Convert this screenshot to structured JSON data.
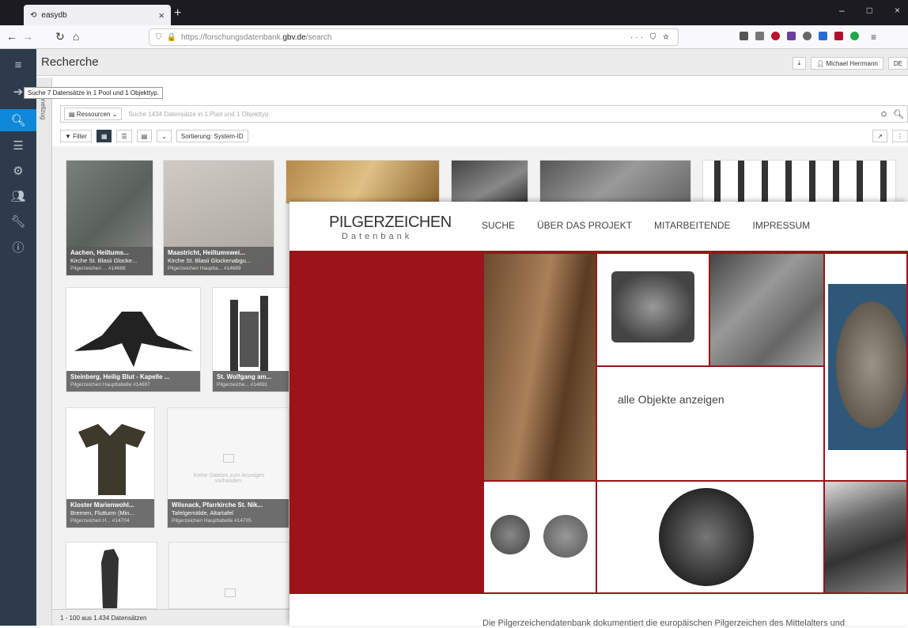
{
  "browser": {
    "tab_title": "easydb",
    "url_prefix": "https://forschungsdatenbank.",
    "url_domain": "gbv.de",
    "url_suffix": "/search"
  },
  "app": {
    "title": "Recherche",
    "user": "Michael Herrmann",
    "lang": "DE",
    "tooltip": "Suche 7 Datensätze in 1 Pool und 1 Objekttyp.",
    "schnellzugriff": "Schnellzug",
    "resources_label": "Ressourcen",
    "search_placeholder": "Suche 1434 Datensätze in 1 Pool und 1 Objekttyp.",
    "filter_label": "Filter",
    "sort_label": "Sortierung: System-ID",
    "status": "1 - 100 aus 1.434 Datensätzen"
  },
  "cards": [
    {
      "title": "Aachen, Heiltums...",
      "sub": "Kirche St. Blasii Glocke...",
      "meta": "Pilgerzeichen ...  #14688"
    },
    {
      "title": "Maastricht, Heiltumswei...",
      "sub": "Kirche St. Blasii Glockenabgu...",
      "meta": "Pilgerzeichen Haupttа...  #14689"
    },
    {
      "title": "Steinberg, Heilig Blut - Kapelle ...",
      "sub": "",
      "meta": "Pilgerzeichen Haupttabelle  #14697"
    },
    {
      "title": "St. Wolfgang am...",
      "sub": "",
      "meta": "Pilgerzeiche...  #14691"
    },
    {
      "title": "Kloster Marienwohl...",
      "sub": "Bremen, Flutturm (Min...",
      "meta": "Pilgerzeichen H...  #14704"
    },
    {
      "title": "Wilsnack, Pfarrkirche St. Nik...",
      "sub": "Tafelgemälde, Altartafel",
      "meta": "Pilgerzeichen Haupttabelle  #14705"
    }
  ],
  "nodata_text": "Keine Dateien zum Anzeigen vorhanden.",
  "site": {
    "logo_main": "PILGERZEICHEN",
    "logo_sub": "Datenbank",
    "nav": [
      "SUCHE",
      "ÜBER DAS PROJEKT",
      "MITARBEITENDE",
      "IMPRESSUM"
    ],
    "alle_link": "alle Objekte anzeigen",
    "intro_text": "Die Pilgerzeichendatenbank dokumentiert die europäischen Pilgerzeichen des Mittelalters und"
  }
}
